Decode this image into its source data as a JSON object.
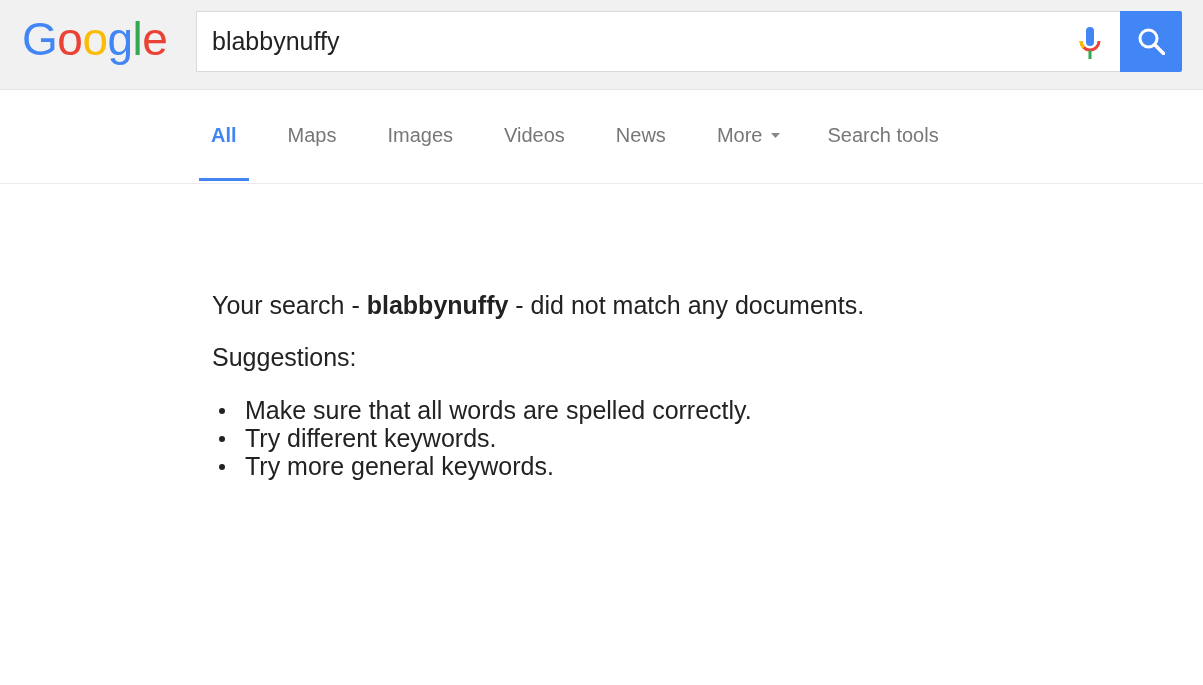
{
  "header": {
    "logo": "Google",
    "search": {
      "value": "blabbynuffy"
    }
  },
  "tabs": [
    {
      "label": "All",
      "selected": true,
      "dropdown": false
    },
    {
      "label": "Maps",
      "selected": false,
      "dropdown": false
    },
    {
      "label": "Images",
      "selected": false,
      "dropdown": false
    },
    {
      "label": "Videos",
      "selected": false,
      "dropdown": false
    },
    {
      "label": "News",
      "selected": false,
      "dropdown": false
    },
    {
      "label": "More",
      "selected": false,
      "dropdown": true
    }
  ],
  "tools_button": "Search tools",
  "results": {
    "message": "Your search - **blabbynuffy** - did not match any documents.",
    "suggestions_heading": "Suggestions:",
    "suggestions": [
      "Make sure that all words are spelled correctly.",
      "Try different keywords.",
      "Try more general keywords."
    ]
  }
}
